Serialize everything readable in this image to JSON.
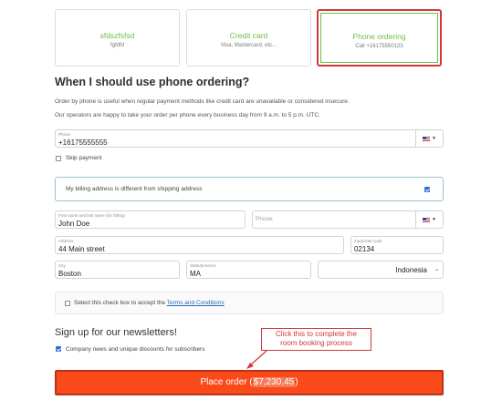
{
  "payment_methods": [
    {
      "title": "sfdszfsfsd",
      "subtitle": "fgfdfd"
    },
    {
      "title": "Credit card",
      "subtitle": "Visa, Mastercard, etc..."
    },
    {
      "title": "Phone ordering",
      "subtitle": "Call +16175550123"
    }
  ],
  "phone_section": {
    "heading": "When I should use phone ordering?",
    "para1": "Order by phone is useful when regular payment methods like credit card are unavailable or considered insecure.",
    "para2": "Our operators are happy to take your order per phone every business day from 9 a.m. to 5 p.m. UTC.",
    "phone_label": "Phone",
    "phone_value": "+16175555555",
    "skip_label": "Skip payment"
  },
  "billing": {
    "different_label": "My billing address is different from shipping address",
    "different_checked": true,
    "name_label": "First name and last name (for billing)",
    "name_value": "John Doe",
    "phone_placeholder": "Phone",
    "address_label": "Address",
    "address_value": "44 Main street",
    "zip_label": "Zip/postal code",
    "zip_value": "02134",
    "city_label": "City",
    "city_value": "Boston",
    "state_label": "State/province",
    "state_value": "MA",
    "country_value": "Indonesia"
  },
  "terms": {
    "prefix": "Select this check box to accept the ",
    "link": "Terms and Conditions"
  },
  "newsletter": {
    "heading": "Sign up for our newsletters!",
    "option_label": "Company news and unique discounts for subscribers",
    "option_checked": true
  },
  "callout": {
    "line1": "Click this to complete the",
    "line2": "room booking process"
  },
  "order": {
    "label": "Place order (",
    "amount": "$7,230.45",
    "suffix": ")"
  },
  "colors": {
    "accent_green": "#6cbd45",
    "highlight_red": "#d0393b",
    "button_orange": "#fb4a1a"
  }
}
